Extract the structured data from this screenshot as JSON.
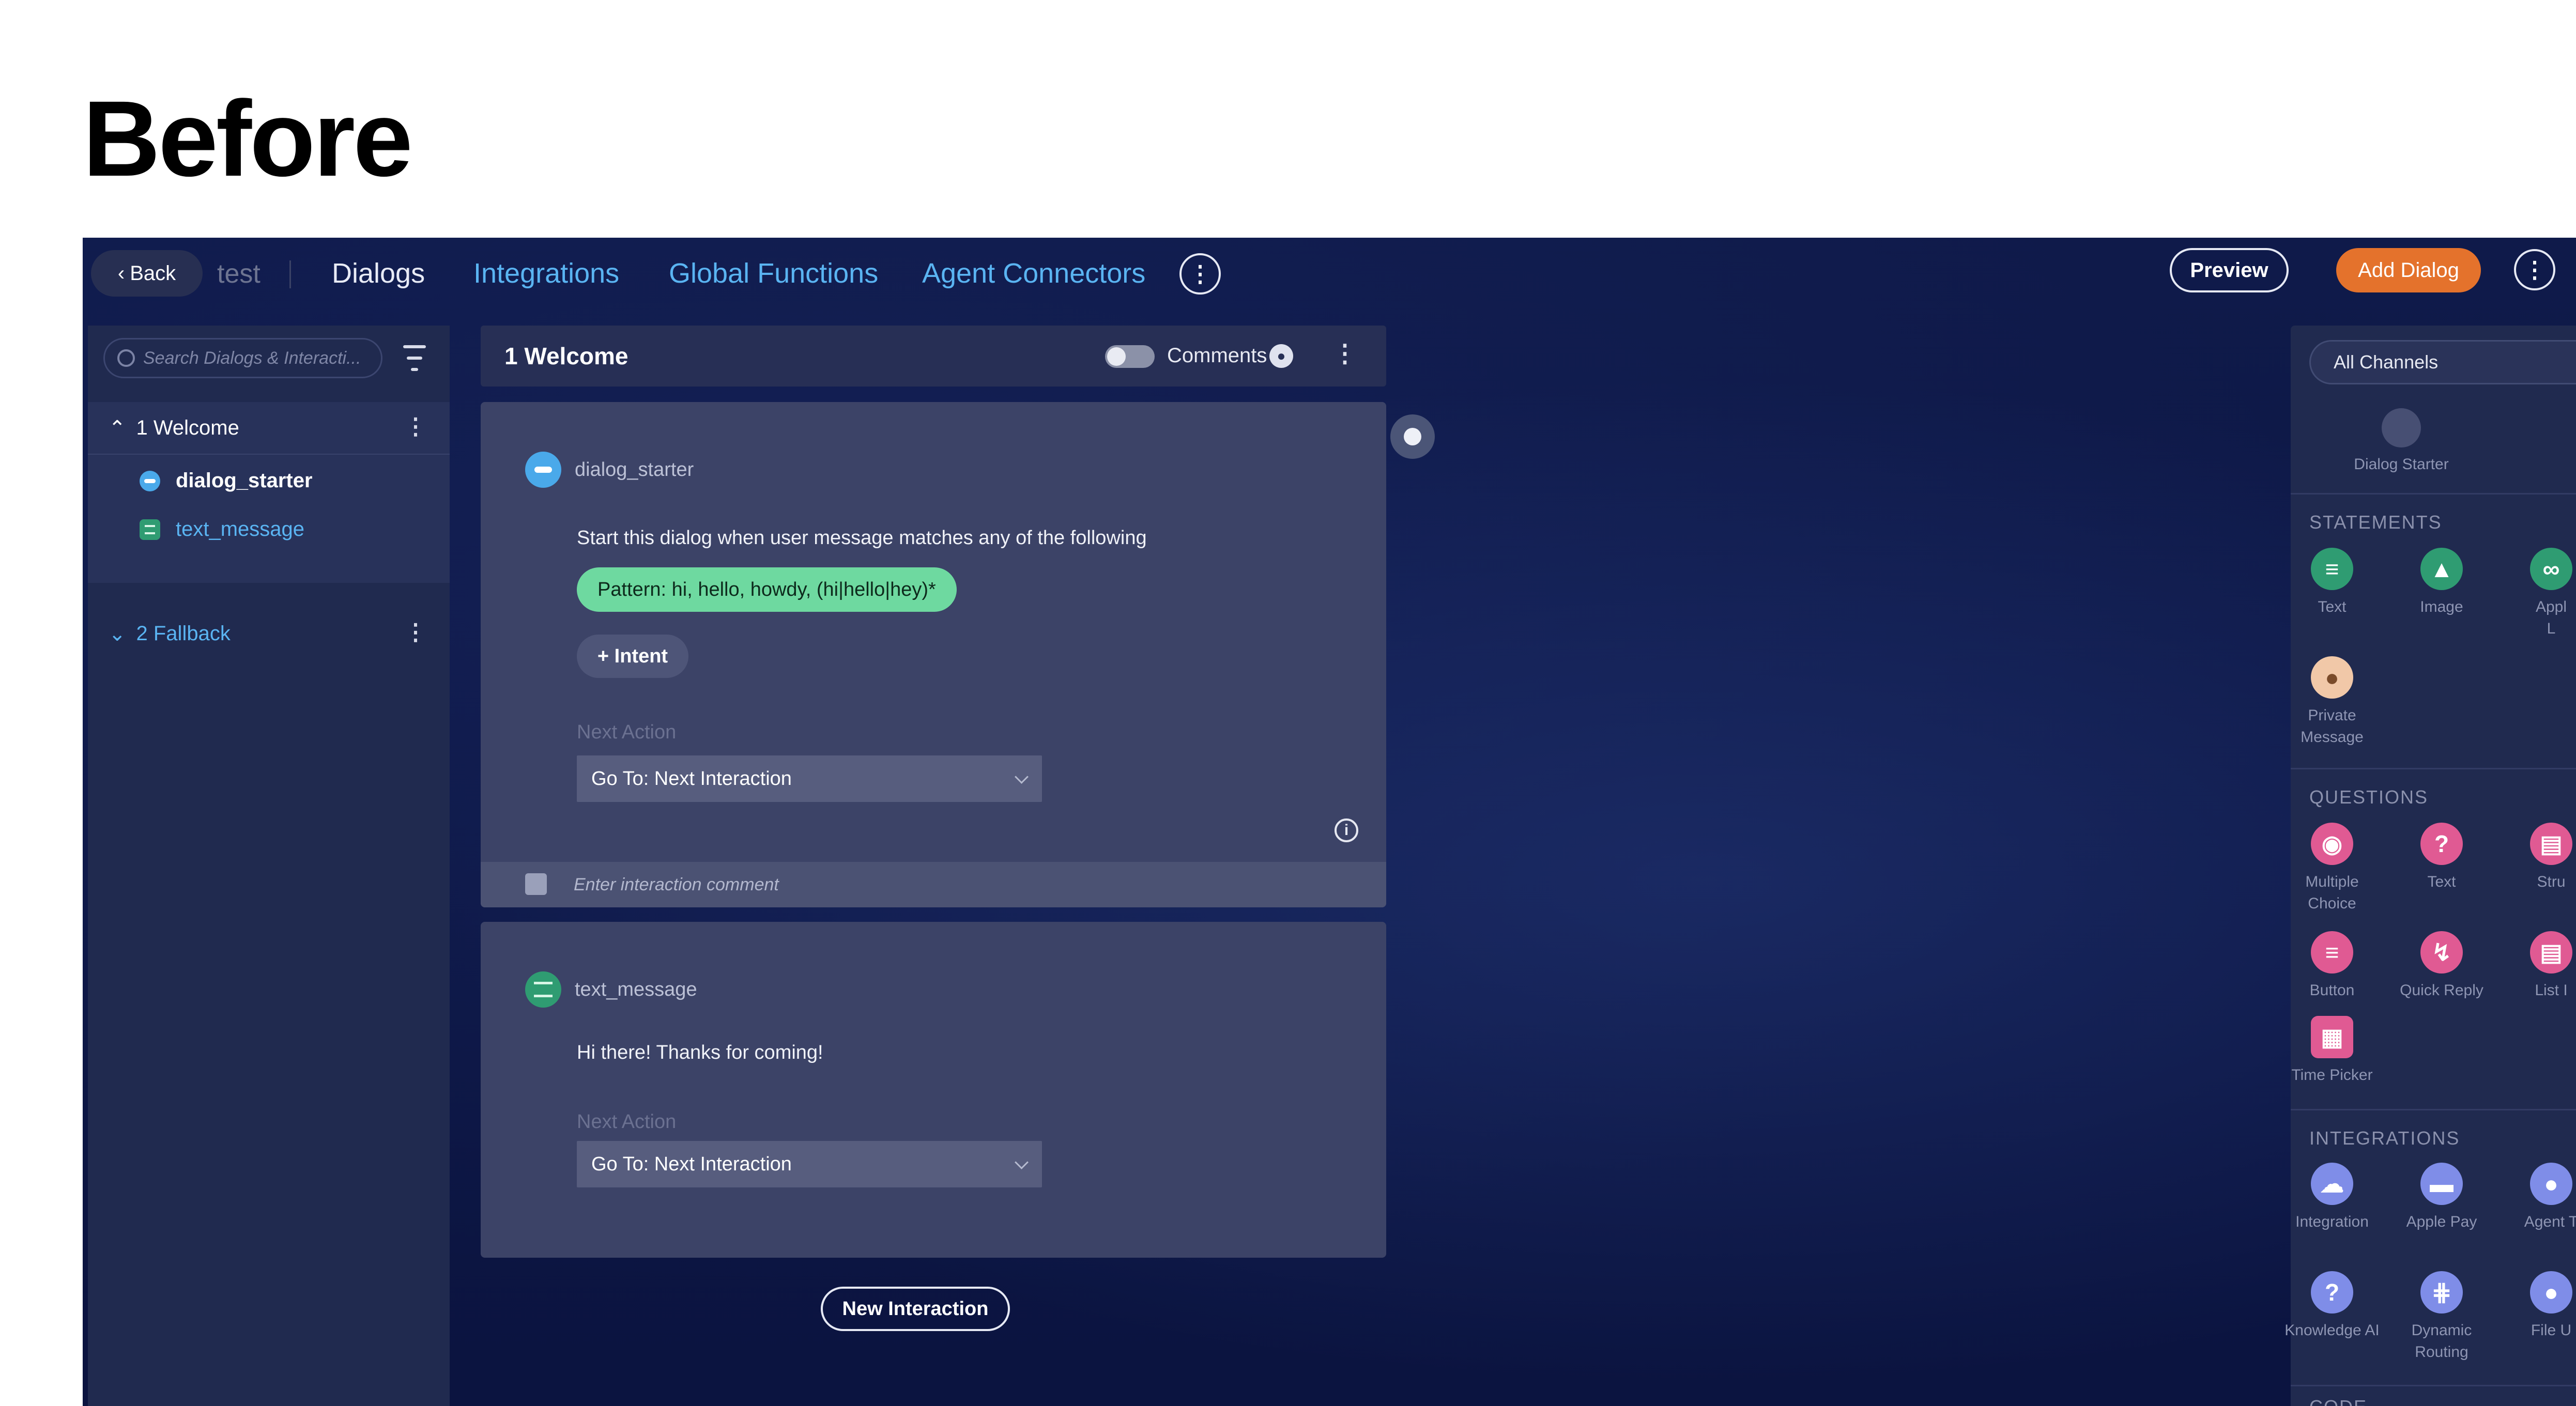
{
  "heading": "Before",
  "topbar": {
    "back_label": "Back",
    "app_name": "test",
    "tabs": [
      "Dialogs",
      "Integrations",
      "Global Functions",
      "Agent Connectors"
    ],
    "preview_label": "Preview",
    "add_dialog_label": "Add Dialog"
  },
  "sidebar": {
    "search_placeholder": "Search Dialogs & Interacti...",
    "groups": [
      {
        "label": "1 Welcome",
        "items": [
          "dialog_starter",
          "text_message"
        ]
      },
      {
        "label": "2 Fallback"
      }
    ]
  },
  "main": {
    "dialog_title": "1 Welcome",
    "comments_label": "Comments",
    "cards": [
      {
        "name": "dialog_starter",
        "text": "Start this dialog when user message matches any of the following",
        "pattern": "Pattern:  hi, hello, howdy, (hi|hello|hey)*",
        "intent_label": "+ Intent",
        "next_action_label": "Next Action",
        "next_action_value": "Go To:  Next Interaction",
        "comment_placeholder": "Enter interaction comment"
      },
      {
        "name": "text_message",
        "text": "Hi there! Thanks for coming!",
        "next_action_label": "Next Action",
        "next_action_value": "Go To:  Next Interaction"
      }
    ],
    "new_interaction_label": "New Interaction"
  },
  "palette": {
    "channel": "All Channels",
    "dialog_starter_label": "Dialog Starter",
    "sections": {
      "statements": "STATEMENTS",
      "questions": "QUESTIONS",
      "integrations": "INTEGRATIONS",
      "code": "CODE"
    },
    "statements": [
      {
        "label": "Text",
        "color": "#78d4a6"
      },
      {
        "label": "Image",
        "color": "#78d4a6"
      },
      {
        "label": "Appl\nL",
        "color": "#78d4a6"
      },
      {
        "label": "Private\nMessage",
        "color": "#f1c8a8"
      }
    ],
    "questions": [
      {
        "label": "Multiple\nChoice",
        "color": "#e05a93"
      },
      {
        "label": "Text",
        "color": "#e05a93"
      },
      {
        "label": "Stru",
        "color": "#e05a93"
      },
      {
        "label": "Button",
        "color": "#e05a93"
      },
      {
        "label": "Quick Reply",
        "color": "#e05a93"
      },
      {
        "label": "List I",
        "color": "#e05a93"
      },
      {
        "label": "Time Picker",
        "color": "#e05a93"
      }
    ],
    "integrations": [
      {
        "label": "Integration",
        "color": "#7f8de8"
      },
      {
        "label": "Apple Pay",
        "color": "#7f8de8"
      },
      {
        "label": "Agent T",
        "color": "#7f8de8"
      },
      {
        "label": "Knowledge AI",
        "color": "#7f8de8"
      },
      {
        "label": "Dynamic\nRouting",
        "color": "#7f8de8"
      },
      {
        "label": "File U",
        "color": "#7f8de8"
      }
    ]
  },
  "colors": {
    "accent_orange": "#e4722c",
    "link_blue": "#5ab4f2",
    "pattern_green": "#6ed9a0",
    "question_pink": "#e05a93",
    "integration_violet": "#7f8de8"
  }
}
